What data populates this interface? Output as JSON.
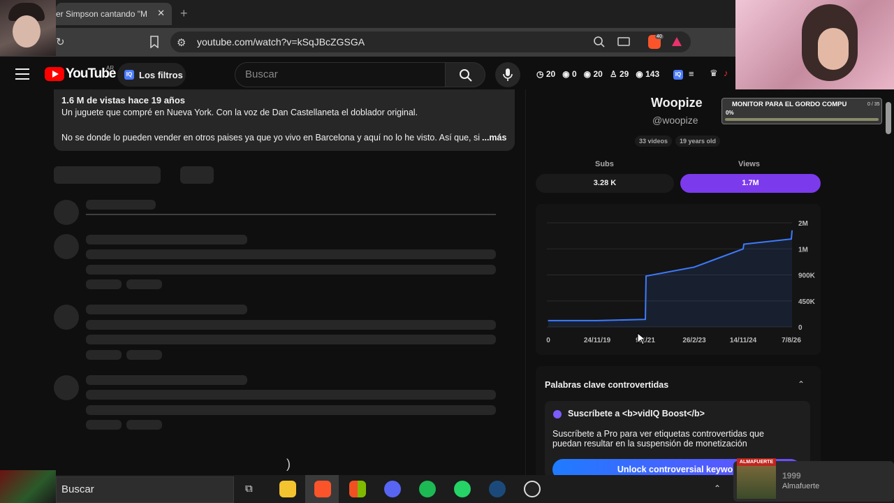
{
  "browser": {
    "tab_title": "er Simpson cantando \"M",
    "url": "youtube.com/watch?v=kSqJBcZGSGA",
    "brave_count": "40"
  },
  "youtube": {
    "logo_text": "YouTube",
    "country": "AR",
    "filters_label": "Los filtros",
    "search_placeholder": "Buscar",
    "stats": [
      "20",
      "0",
      "20",
      "29",
      "143"
    ]
  },
  "description": {
    "meta": "1.6 M de vistas  hace 19 años",
    "line1": "Un juguete que compré en Nueva York. Con la voz de Dan Castellaneta el doblador original.",
    "line2": "No se donde lo pueden vender en otros paises ya que yo vivo en Barcelona  y aquí no lo he visto. Así que, si",
    "more": "...más"
  },
  "channel": {
    "name": "Woopize",
    "handle": "@woopize",
    "videos": "33 videos",
    "age": "19 years old",
    "subs_label": "Subs",
    "views_label": "Views",
    "subs_value": "3.28 K",
    "views_value": "1.7M"
  },
  "chart_data": {
    "type": "area",
    "x_ticks": [
      "0",
      "24/11/19",
      "9/2/21",
      "26/2/23",
      "14/11/24",
      "7/8/26"
    ],
    "y_ticks": [
      "2M",
      "1M",
      "900K",
      "450K",
      "0"
    ],
    "series": [
      {
        "values": [
          {
            "x": "0",
            "y": 110000
          },
          {
            "x": "24/11/19",
            "y": 110000
          },
          {
            "x": "9/2/21",
            "y": 130000
          },
          {
            "x": "9/2/21",
            "y": 880000
          },
          {
            "x": "26/2/23",
            "y": 930000
          },
          {
            "x": "14/11/24",
            "y": 1000000
          },
          {
            "x": "14/11/24",
            "y": 1180000
          },
          {
            "x": "7/8/26",
            "y": 1380000
          },
          {
            "x": "7/8/26",
            "y": 1700000
          }
        ]
      }
    ],
    "color": "#3d7bff"
  },
  "keywords": {
    "title": "Palabras clave controvertidas",
    "sub_title": "Suscríbete a <b>vidIQ Boost</b>",
    "sub_text": "Suscríbete a Pro para ver etiquetas controvertidas que puedan resultar en la suspensión de monetización",
    "unlock": "Unlock controversial keywor"
  },
  "overlay": {
    "goal_title": "MONITOR PARA EL GORDO COMPU",
    "goal_count": "0 / 35",
    "goal_pct": "0%",
    "goal_fraction": 0.0
  },
  "taskbar": {
    "search": "Buscar",
    "now_playing_banner": "ALMAFUERTE",
    "now_playing_title": "1999",
    "now_playing_artist": "Almafuerte"
  },
  "colors": {
    "accent_purple": "#7c3aed",
    "yt_red": "#ff0000",
    "line_blue": "#3d7bff"
  }
}
